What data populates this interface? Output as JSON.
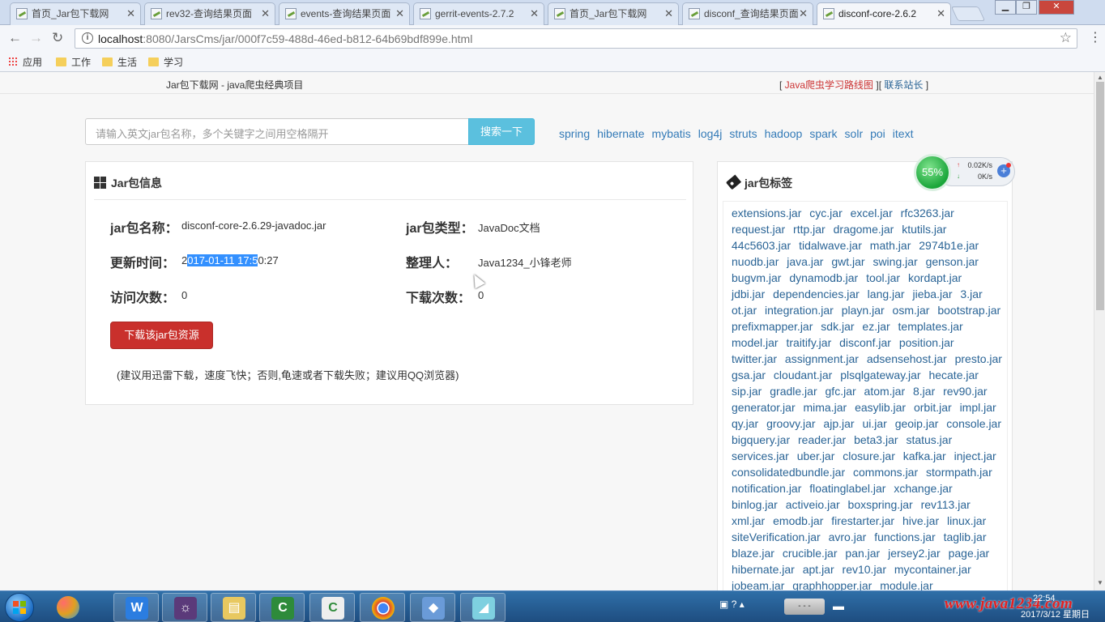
{
  "browser": {
    "tabs": [
      {
        "title": "首页_Jar包下载网"
      },
      {
        "title": "rev32-查询结果页面"
      },
      {
        "title": "events-查询结果页面"
      },
      {
        "title": "gerrit-events-2.7.2"
      },
      {
        "title": "首页_Jar包下载网"
      },
      {
        "title": "disconf_查询结果页面"
      },
      {
        "title": "disconf-core-2.6.2"
      }
    ],
    "address": {
      "host": "localhost",
      "path": ":8080/JarsCms/jar/000f7c59-488d-46ed-b812-64b69bdf899e.html"
    },
    "bookmarks": [
      "应用",
      "工作",
      "生活",
      "学习"
    ]
  },
  "site": {
    "name": "Jar包下载网 - java爬虫经典项目",
    "link_open": "[ ",
    "link_route": "Java爬虫学习路线图",
    "link_sep": " ][ ",
    "link_contact": "联系站长",
    "link_close": " ]"
  },
  "search": {
    "placeholder": "请输入英文jar包名称，多个关键字之间用空格隔开",
    "button": "搜索一下",
    "quick_links": [
      "spring",
      "hibernate",
      "mybatis",
      "log4j",
      "struts",
      "hadoop",
      "spark",
      "solr",
      "poi",
      "itext"
    ]
  },
  "jar_info": {
    "heading": "Jar包信息",
    "name_label": "jar包名称：",
    "name_value": "disconf-core-2.6.29-javadoc.jar",
    "type_label": "jar包类型：",
    "type_value": "JavaDoc文档",
    "updated_label": "更新时间：",
    "updated_pre": "2",
    "updated_sel": "017-01-11 17:5",
    "updated_post": "0:27",
    "author_label": "整理人：",
    "author_value": "Java1234_小锋老师",
    "visits_label": "访问次数：",
    "visits_value": "0",
    "downloads_label": "下载次数：",
    "downloads_value": "0",
    "download_button": "下载该jar包资源",
    "hint": "(建议用迅雷下载，速度飞快；否则,龟速或者下载失败；建议用QQ浏览器)"
  },
  "tags": {
    "heading": "jar包标签",
    "items": [
      "extensions.jar",
      "cyc.jar",
      "excel.jar",
      "rfc3263.jar",
      "request.jar",
      "rttp.jar",
      "dragome.jar",
      "ktutils.jar",
      "44c5603.jar",
      "tidalwave.jar",
      "math.jar",
      "2974b1e.jar",
      "nuodb.jar",
      "java.jar",
      "gwt.jar",
      "swing.jar",
      "genson.jar",
      "bugvm.jar",
      "dynamodb.jar",
      "tool.jar",
      "kordapt.jar",
      "jdbi.jar",
      "dependencies.jar",
      "lang.jar",
      "jieba.jar",
      "3.jar",
      "ot.jar",
      "integration.jar",
      "playn.jar",
      "osm.jar",
      "bootstrap.jar",
      "prefixmapper.jar",
      "sdk.jar",
      "ez.jar",
      "templates.jar",
      "model.jar",
      "traitify.jar",
      "disconf.jar",
      "position.jar",
      "twitter.jar",
      "assignment.jar",
      "adsensehost.jar",
      "presto.jar",
      "gsa.jar",
      "cloudant.jar",
      "plsqlgateway.jar",
      "hecate.jar",
      "sip.jar",
      "gradle.jar",
      "gfc.jar",
      "atom.jar",
      "8.jar",
      "rev90.jar",
      "generator.jar",
      "mima.jar",
      "easylib.jar",
      "orbit.jar",
      "impl.jar",
      "qy.jar",
      "groovy.jar",
      "ajp.jar",
      "ui.jar",
      "geoip.jar",
      "console.jar",
      "bigquery.jar",
      "reader.jar",
      "beta3.jar",
      "status.jar",
      "services.jar",
      "uber.jar",
      "closure.jar",
      "kafka.jar",
      "inject.jar",
      "consolidatedbundle.jar",
      "commons.jar",
      "stormpath.jar",
      "notification.jar",
      "floatinglabel.jar",
      "xchange.jar",
      "binlog.jar",
      "activeio.jar",
      "boxspring.jar",
      "rev113.jar",
      "xml.jar",
      "emodb.jar",
      "firestarter.jar",
      "hive.jar",
      "linux.jar",
      "siteVerification.jar",
      "avro.jar",
      "functions.jar",
      "taglib.jar",
      "blaze.jar",
      "crucible.jar",
      "pan.jar",
      "jersey2.jar",
      "page.jar",
      "hibernate.jar",
      "apt.jar",
      "rev10.jar",
      "mycontainer.jar",
      "jobeam.jar",
      "graphhopper.jar",
      "module.jar"
    ]
  },
  "speed_widget": {
    "percent": "55%",
    "up": "0.02K/s",
    "down": "0K/s"
  },
  "taskbar": {
    "watermark": "www.java1234.com",
    "time": "22:54",
    "date": "2017/3/12 星期日"
  }
}
